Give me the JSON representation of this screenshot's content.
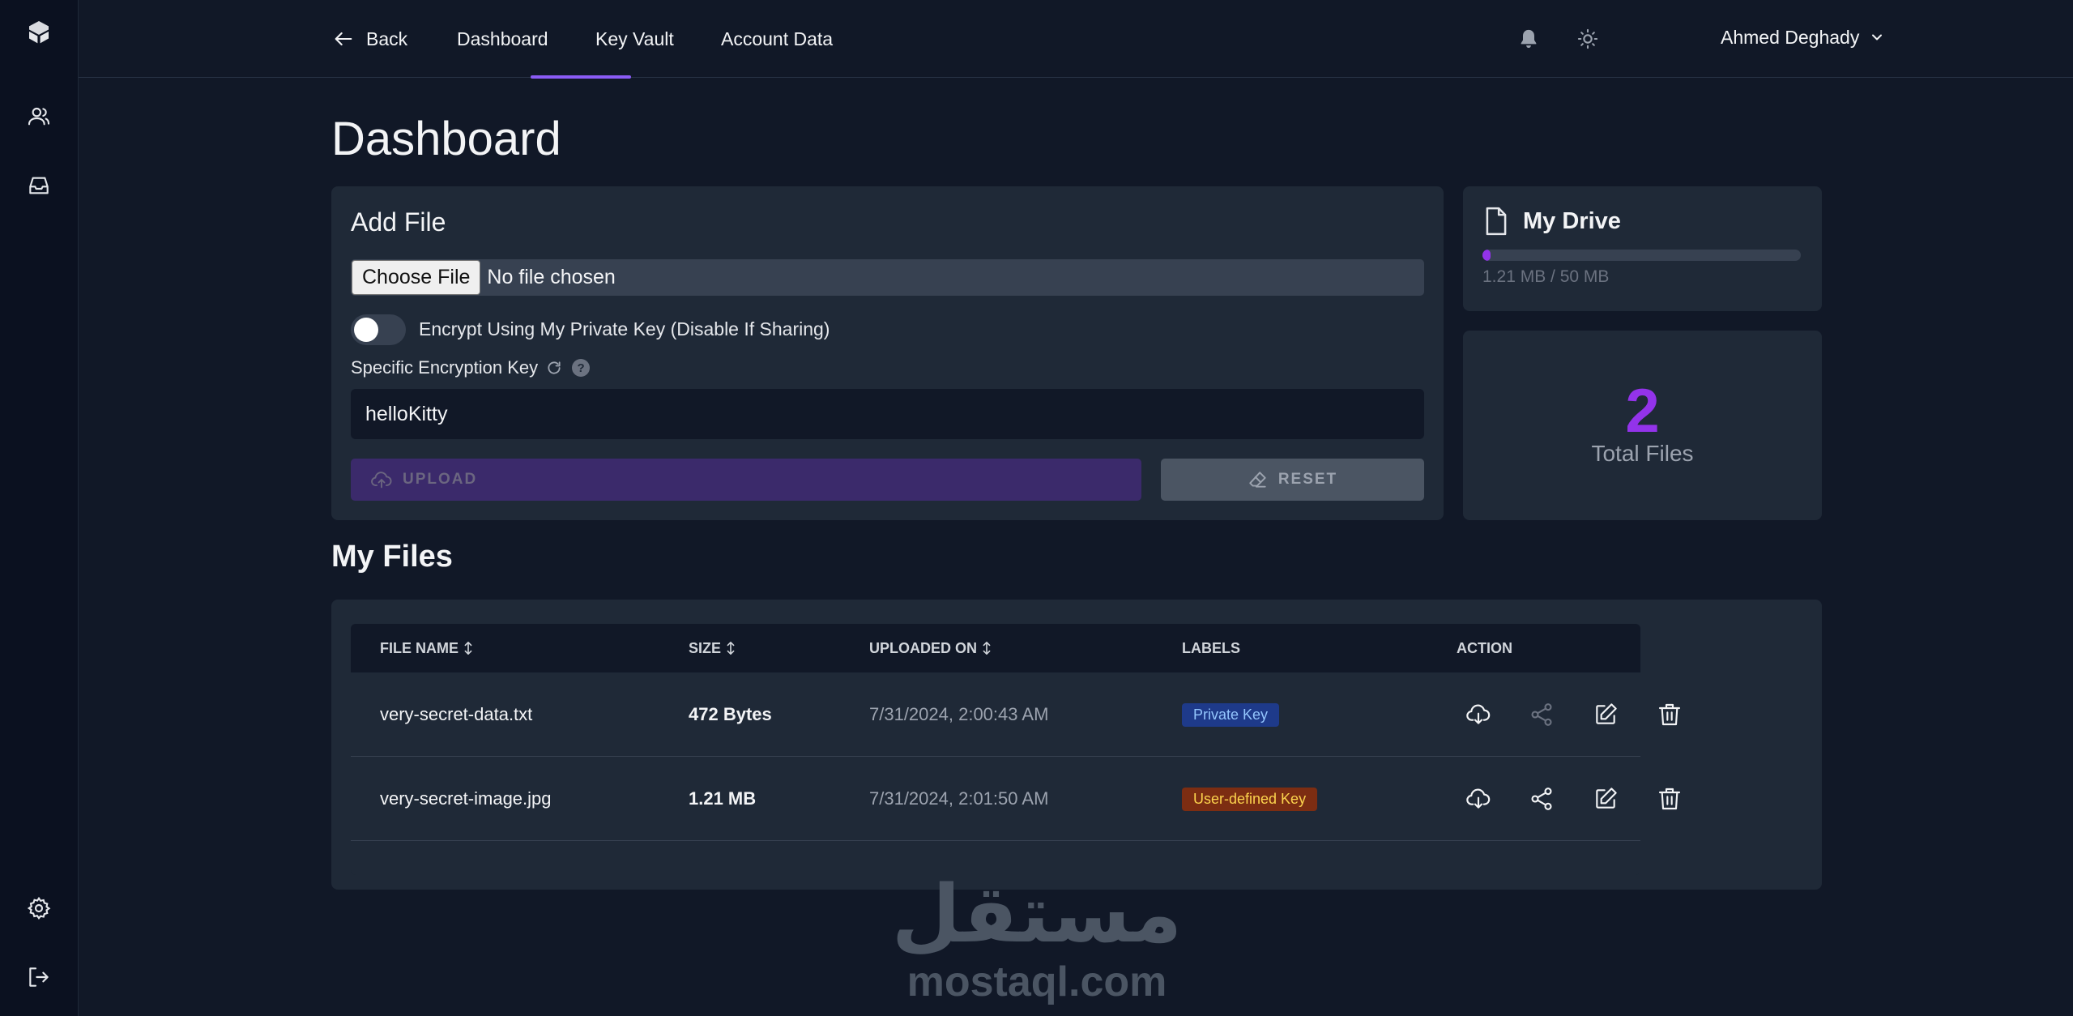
{
  "nav": {
    "back": "Back",
    "tabs": [
      "Dashboard",
      "Key Vault",
      "Account Data"
    ],
    "active_tab": "Dashboard",
    "user_name": "Ahmed Deghady"
  },
  "page": {
    "title": "Dashboard"
  },
  "add_file": {
    "title": "Add File",
    "choose_button": "Choose File",
    "no_file_text": "No file chosen",
    "encrypt_toggle_label": "Encrypt Using My Private Key (Disable If Sharing)",
    "encrypt_toggle_on": false,
    "key_label": "Specific Encryption Key",
    "help": "?",
    "key_value": "helloKitty",
    "upload_label": "UPLOAD",
    "reset_label": "RESET"
  },
  "drive": {
    "title": "My Drive",
    "usage_text": "1.21 MB / 50 MB",
    "used_fraction": 0.0242,
    "total_files": "2",
    "total_files_label": "Total Files"
  },
  "files": {
    "title": "My Files",
    "columns": {
      "name": "FILE NAME",
      "size": "SIZE",
      "uploaded": "UPLOADED ON",
      "labels": "LABELS",
      "action": "ACTION"
    },
    "rows": [
      {
        "name": "very-secret-data.txt",
        "size": "472 Bytes",
        "uploaded": "7/31/2024, 2:00:43 AM",
        "label": "Private Key",
        "label_bg": "#1e3a8a",
        "label_fg": "#93c5fd",
        "share_enabled": false
      },
      {
        "name": "very-secret-image.jpg",
        "size": "1.21 MB",
        "uploaded": "7/31/2024, 2:01:50 AM",
        "label": "User-defined Key",
        "label_bg": "#7c2d12",
        "label_fg": "#fcd34d",
        "share_enabled": true
      }
    ]
  },
  "watermark": {
    "arabic": "مستقل",
    "latin": "mostaql.com"
  },
  "colors": {
    "accent": "#9333ea",
    "nav_underline": "#8b5cf6",
    "background": "#111827",
    "card": "#1f2937"
  }
}
